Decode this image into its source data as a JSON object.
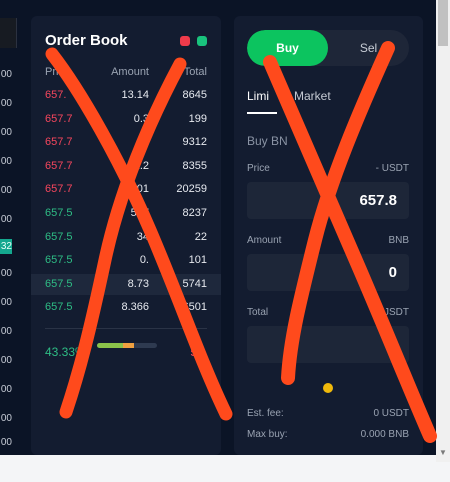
{
  "left_column": {
    "numbers": [
      "00",
      "00",
      "00",
      "00",
      "00",
      "00",
      "00",
      "00",
      "00",
      "00",
      "00",
      "00",
      "00",
      "00"
    ],
    "highlight": "32"
  },
  "order_book": {
    "title": "Order Book",
    "headers": {
      "price": "Price",
      "amount": "Amount",
      "total": "Total"
    },
    "rows": [
      {
        "price": "657.",
        "amount": "13.14",
        "total": "8645",
        "side": "sell"
      },
      {
        "price": "657.7",
        "amount": "0.3",
        "total": "199",
        "side": "sell"
      },
      {
        "price": "657.7",
        "amount": "14",
        "total": "9312",
        "side": "sell"
      },
      {
        "price": "657.7",
        "amount": "12.2",
        "total": "8355",
        "side": "sell"
      },
      {
        "price": "657.7",
        "amount": "01",
        "total": "20259",
        "side": "sell"
      },
      {
        "price": "657.5",
        "amount": "527",
        "total": "8237",
        "side": "buy"
      },
      {
        "price": "657.5",
        "amount": "34",
        "total": "22",
        "side": "buy"
      },
      {
        "price": "657.5",
        "amount": "0.",
        "total": "101",
        "side": "buy"
      },
      {
        "price": "657.5",
        "amount": "8.73",
        "total": "5741",
        "side": "buy",
        "highlight": true
      },
      {
        "price": "657.5",
        "amount": "8.366",
        "total": "6501",
        "side": "buy"
      }
    ],
    "buy_pct": "43.33",
    "sell_pct": "56.",
    "ratio": {
      "buy": 0.4333,
      "mid_end": 0.62
    },
    "colors": {
      "sell": "#f6465d",
      "buy": "#2ebd85"
    }
  },
  "trade_panel": {
    "buy_label": "Buy",
    "sell_label": "Sel",
    "tab_limit": "Limi",
    "tab_market": "Market",
    "buy_asset": "Buy BN",
    "price": {
      "label": "Price",
      "unit": "- USDT",
      "value": "657.8"
    },
    "amount": {
      "label": "Amount",
      "unit": "BNB",
      "value": "0"
    },
    "total": {
      "label": "Total",
      "unit": "JSDT",
      "value": ""
    },
    "est_fee_label": "Est. fee:",
    "est_fee_value": "0 USDT",
    "max_buy_label": "Max buy:",
    "max_buy_value": "0.000 BNB",
    "accent": "#0cc45f",
    "slider_color": "#f0b90b"
  },
  "marks_color": "#ff4a1c"
}
